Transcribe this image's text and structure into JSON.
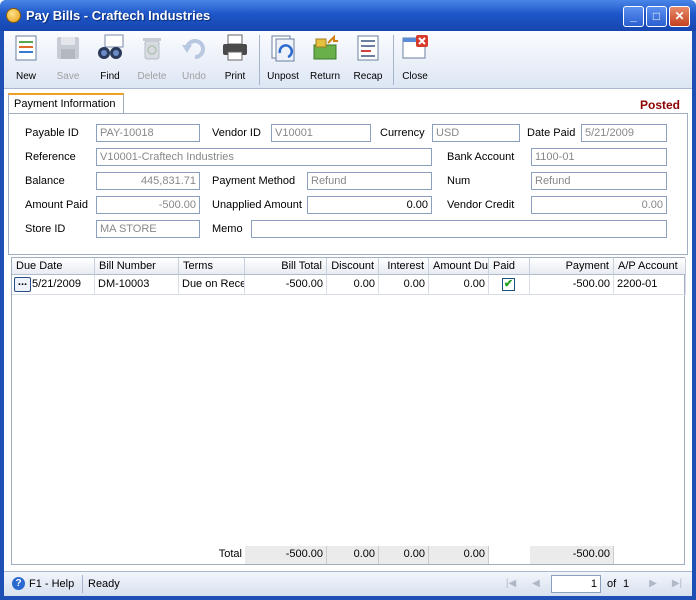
{
  "window": {
    "title": "Pay Bills - Craftech Industries"
  },
  "toolbar": {
    "new": "New",
    "save": "Save",
    "find": "Find",
    "delete": "Delete",
    "undo": "Undo",
    "print": "Print",
    "unpost": "Unpost",
    "return": "Return",
    "recap": "Recap",
    "close": "Close"
  },
  "tab": {
    "label": "Payment Information",
    "status": "Posted"
  },
  "form": {
    "payable_id_label": "Payable ID",
    "payable_id": "PAY-10018",
    "vendor_id_label": "Vendor ID",
    "vendor_id": "V10001",
    "currency_label": "Currency",
    "currency": "USD",
    "date_paid_label": "Date Paid",
    "date_paid": "5/21/2009",
    "reference_label": "Reference",
    "reference": "V10001-Craftech Industries",
    "bank_account_label": "Bank Account",
    "bank_account": "1100-01",
    "balance_label": "Balance",
    "balance": "445,831.71",
    "payment_method_label": "Payment Method",
    "payment_method": "Refund",
    "num_label": "Num",
    "num": "Refund",
    "amount_paid_label": "Amount Paid",
    "amount_paid": "-500.00",
    "unapplied_label": "Unapplied Amount",
    "unapplied": "0.00",
    "vendor_credit_label": "Vendor Credit",
    "vendor_credit": "0.00",
    "store_id_label": "Store ID",
    "store_id": "MA STORE",
    "memo_label": "Memo",
    "memo": ""
  },
  "grid": {
    "headers": [
      "Due Date",
      "Bill Number",
      "Terms",
      "Bill Total",
      "Discount",
      "Interest",
      "Amount Due",
      "Paid",
      "Payment",
      "A/P Account"
    ],
    "rows": [
      {
        "due_date": "5/21/2009",
        "bill_number": "DM-10003",
        "terms": "Due on Rece",
        "bill_total": "-500.00",
        "discount": "0.00",
        "interest": "0.00",
        "amount_due": "0.00",
        "paid": true,
        "payment": "-500.00",
        "ap_account": "2200-01"
      }
    ],
    "totals": {
      "label": "Total",
      "bill_total": "-500.00",
      "discount": "0.00",
      "interest": "0.00",
      "amount_due": "0.00",
      "payment": "-500.00"
    }
  },
  "statusbar": {
    "help": "F1 - Help",
    "status": "Ready",
    "page": "1",
    "of_label": "of",
    "page_count": "1"
  }
}
